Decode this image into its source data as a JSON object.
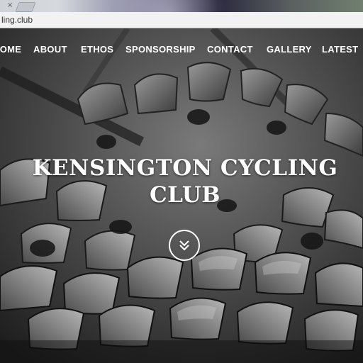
{
  "browser": {
    "tab_close_glyph": "×",
    "url": "ling.club"
  },
  "nav": {
    "items": [
      {
        "label": "HOME"
      },
      {
        "label": "ABOUT"
      },
      {
        "label": "ETHOS"
      },
      {
        "label": "SPONSORSHIP"
      },
      {
        "label": "CONTACT"
      },
      {
        "label": "GALLERY"
      },
      {
        "label": "LATEST"
      }
    ]
  },
  "hero": {
    "title_line1": "KENSINGTON CYCLING",
    "title_line2": "CLUB",
    "scroll_icon": "double-chevron-down-icon"
  },
  "colors": {
    "nav_text": "#ffffff",
    "hero_text": "#ffffff"
  }
}
